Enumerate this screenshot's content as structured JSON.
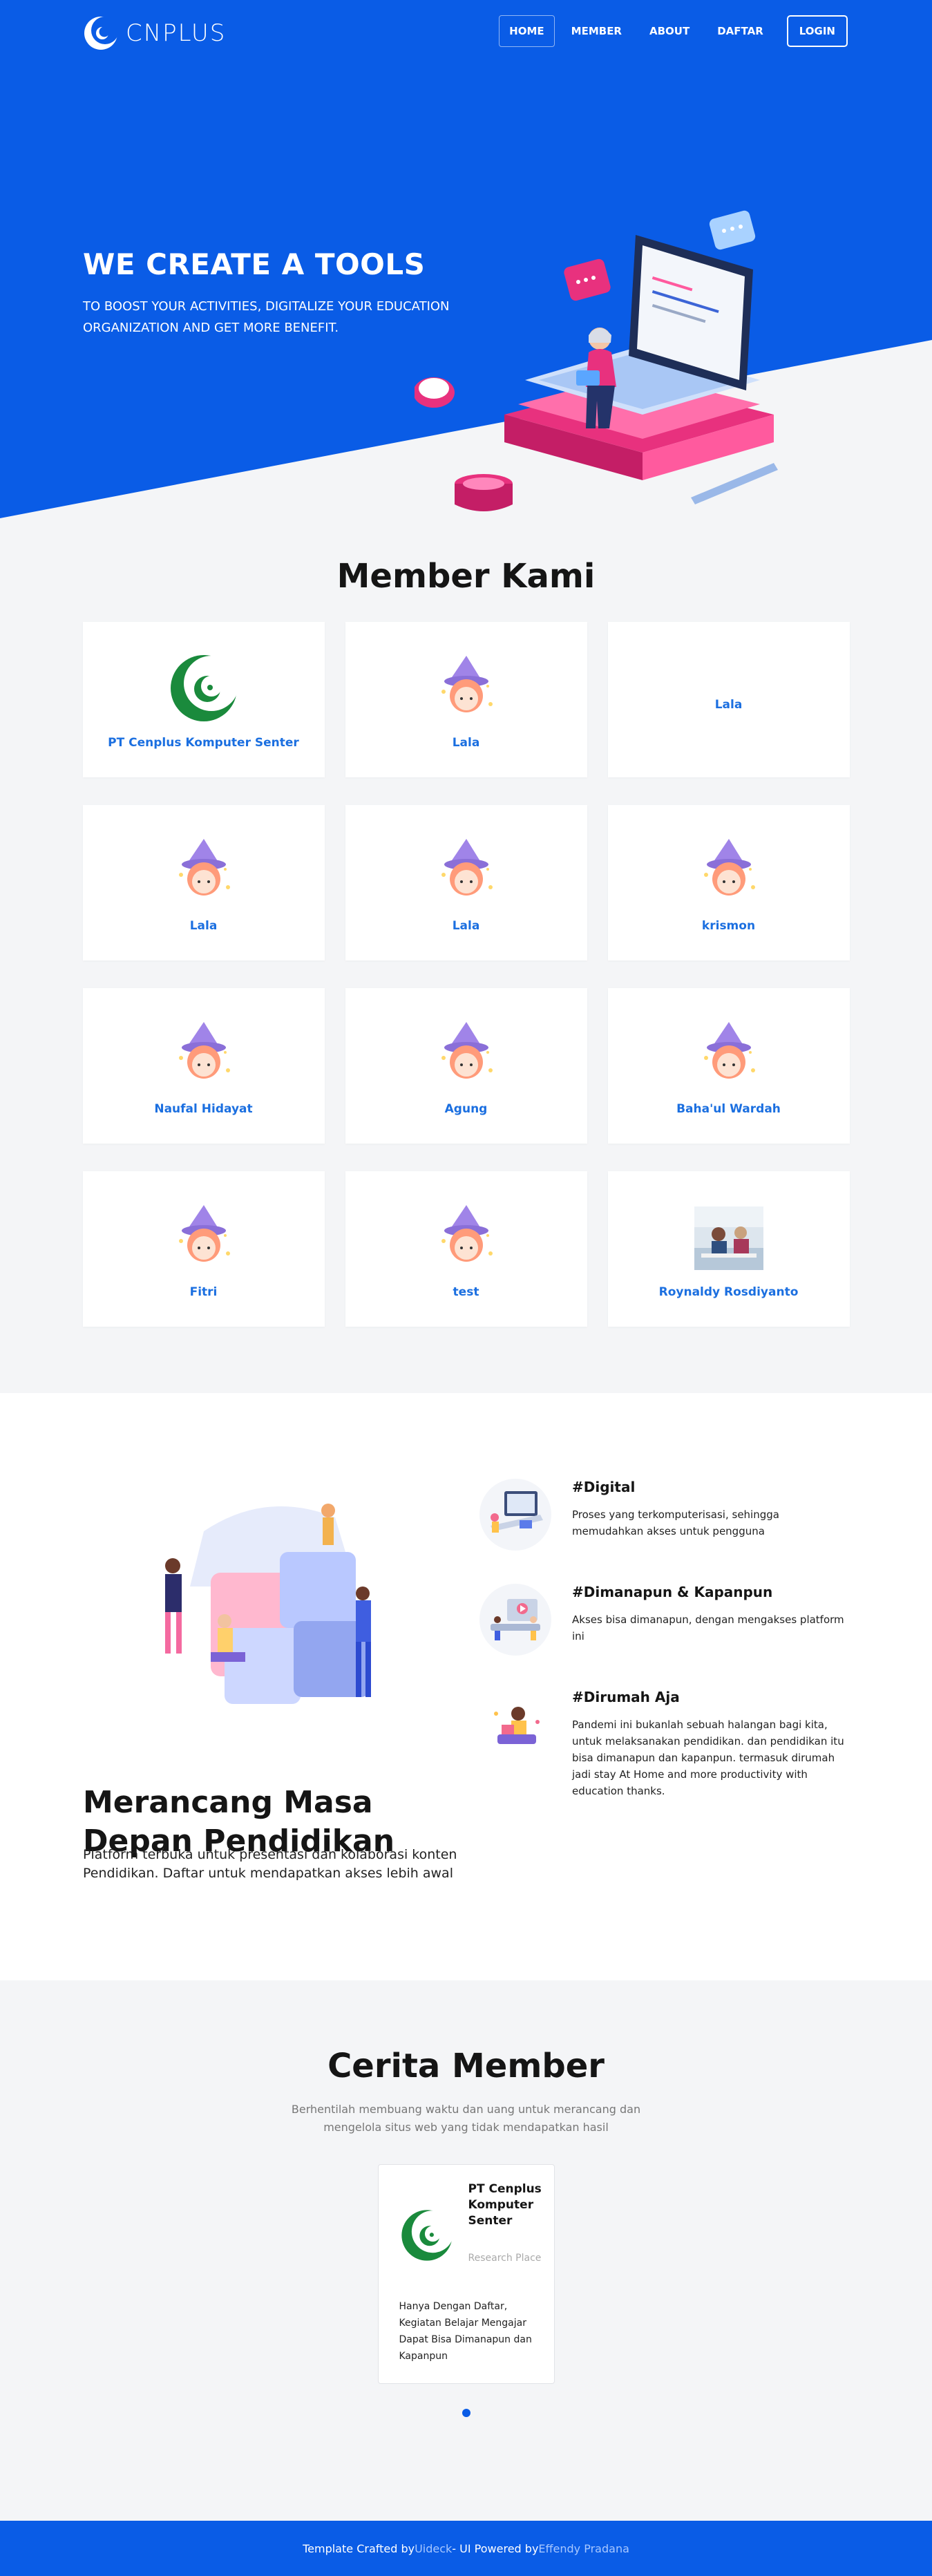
{
  "nav": {
    "brand": "CNPLUS",
    "items": [
      {
        "label": "HOME"
      },
      {
        "label": "MEMBER"
      },
      {
        "label": "ABOUT"
      },
      {
        "label": "DAFTAR"
      }
    ],
    "login": "LOGIN"
  },
  "hero": {
    "title": "WE CREATE A TOOLS",
    "subtitle": "TO BOOST YOUR ACTIVITIES, DIGITALIZE YOUR EDUCATION ORGANIZATION AND GET MORE BENEFIT."
  },
  "members": {
    "title": "Member Kami",
    "items": [
      {
        "name": "PT Cenplus Komputer Senter",
        "avatar": "cenplus-logo"
      },
      {
        "name": "Lala",
        "avatar": "witch-girl"
      },
      {
        "name": "Lala",
        "avatar": "none"
      },
      {
        "name": "Lala",
        "avatar": "witch-girl"
      },
      {
        "name": "Lala",
        "avatar": "witch-girl"
      },
      {
        "name": "krismon",
        "avatar": "witch-girl"
      },
      {
        "name": "Naufal Hidayat",
        "avatar": "witch-girl"
      },
      {
        "name": "Agung",
        "avatar": "witch-girl"
      },
      {
        "name": "Baha'ul Wardah",
        "avatar": "witch-girl"
      },
      {
        "name": "Fitri",
        "avatar": "witch-girl"
      },
      {
        "name": "test",
        "avatar": "witch-girl"
      },
      {
        "name": "Roynaldy Rosdiyanto",
        "avatar": "photo"
      }
    ]
  },
  "feature": {
    "title": "Merancang Masa Depan Pendidikan",
    "text": "Platform terbuka untuk presentasi dan kolaborasi konten Pendidikan. Daftar untuk mendapatkan akses lebih awal",
    "items": [
      {
        "title": "#Digital",
        "text": "Proses yang terkomputerisasi, sehingga memudahkan akses untuk pengguna",
        "icon": "computer-desk-icon"
      },
      {
        "title": "#Dimanapun & Kapanpun",
        "text": "Akses bisa dimanapun, dengan mengakses platform ini",
        "icon": "video-meeting-icon"
      },
      {
        "title": "#Dirumah Aja",
        "text": "Pandemi ini bukanlah sebuah halangan bagi kita, untuk melaksanakan pendidikan. dan pendidikan itu bisa dimanapun dan kapanpun. termasuk dirumah jadi stay At Home and more productivity with education thanks.",
        "icon": "home-study-icon"
      }
    ]
  },
  "story": {
    "title": "Cerita Member",
    "subtitle": "Berhentilah membuang waktu dan uang untuk merancang dan mengelola situs web yang tidak mendapatkan hasil",
    "testimonial": {
      "name": "PT Cenplus Komputer Senter",
      "role": "Research Place",
      "text": "Hanya Dengan Daftar, Kegiatan Belajar Mengajar Dapat Bisa Dimanapun dan Kapanpun"
    }
  },
  "footer": {
    "prefix": "Template Crafted by ",
    "link1": "Uideck",
    "middle": " - UI Powered by ",
    "link2": "Effendy Pradana"
  },
  "colors": {
    "primary": "#0a5ce6",
    "link": "#1b6fe0",
    "background": "#f4f5f7"
  }
}
